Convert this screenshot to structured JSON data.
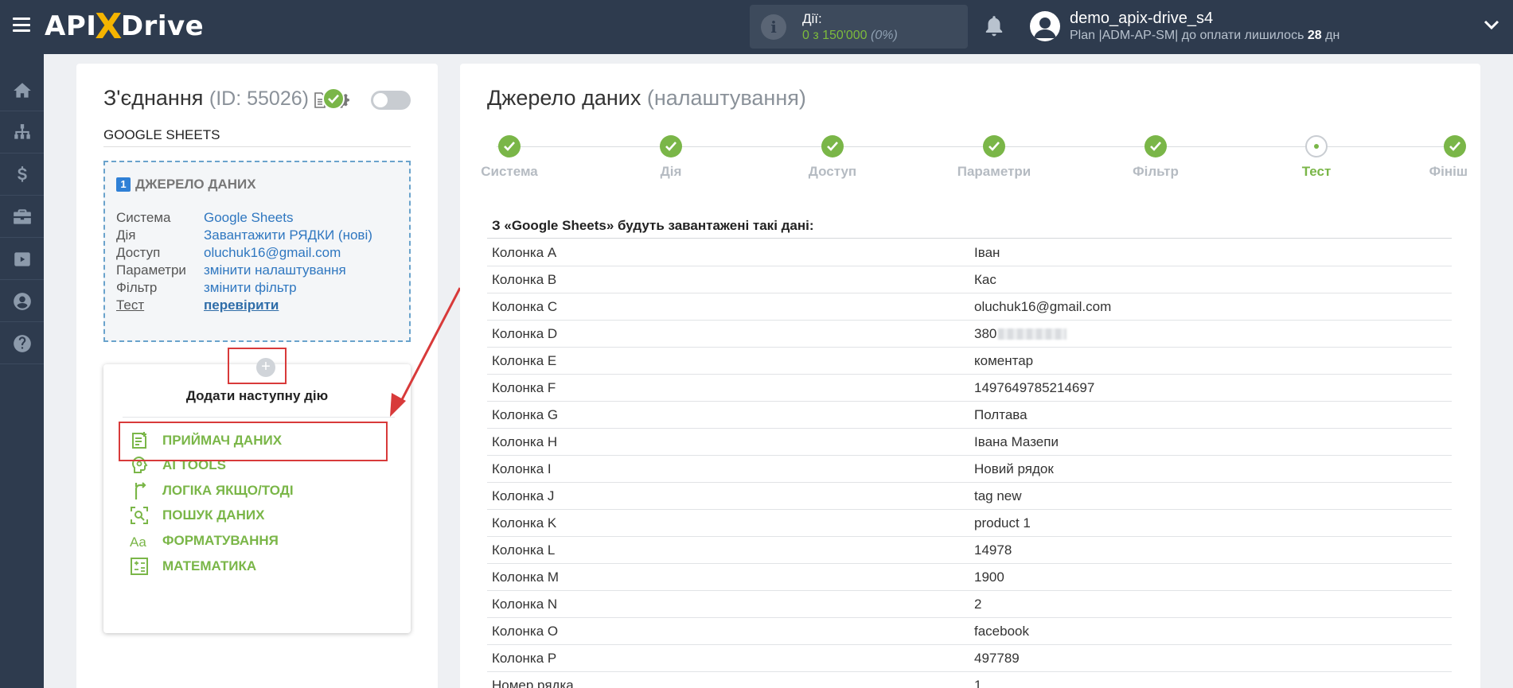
{
  "header": {
    "logo": {
      "part1": "API",
      "x": "X",
      "part2": "Drive"
    },
    "actions_label": "Дії:",
    "actions_value": "0 з 150'000",
    "actions_percent": "(0%)",
    "user_name": "demo_apix-drive_s4",
    "plan_text": "Plan |ADM-AP-SM| до оплати лишилось ",
    "plan_days": "28",
    "plan_days_unit": " дн"
  },
  "nav": {
    "icons": [
      "home-icon",
      "sitemap-icon",
      "dollar-icon",
      "briefcase-icon",
      "youtube-icon",
      "user-icon",
      "help-icon"
    ]
  },
  "connection": {
    "title": "З'єднання",
    "id_text": "(ID: 55026)",
    "service_title": "GOOGLE SHEETS",
    "source": {
      "number": "1",
      "heading": "ДЖЕРЕЛО ДАНИХ",
      "rows": [
        {
          "key": "Система",
          "value": "Google Sheets"
        },
        {
          "key": "Дія",
          "value": "Завантажити РЯДКИ (нові)"
        },
        {
          "key": "Доступ",
          "value": "oluchuk16@gmail.com"
        },
        {
          "key": "Параметри",
          "value": "змінити налаштування"
        },
        {
          "key": "Фільтр",
          "value": "змінити фільтр"
        },
        {
          "key": "Тест",
          "value": "перевірити"
        }
      ]
    },
    "add_next": {
      "title": "Додати наступну дію",
      "items": [
        {
          "label": "ПРИЙМАЧ ДАНИХ",
          "icon": "receiver-icon"
        },
        {
          "label": "AI TOOLS",
          "icon": "ai-head-icon"
        },
        {
          "label": "ЛОГІКА ЯКЩО/ТОДІ",
          "icon": "branch-icon"
        },
        {
          "label": "ПОШУК ДАНИХ",
          "icon": "search-data-icon"
        },
        {
          "label": "ФОРМАТУВАННЯ",
          "icon": "format-icon"
        },
        {
          "label": "МАТЕМАТИКА",
          "icon": "calculator-icon"
        }
      ]
    }
  },
  "source_panel": {
    "title": "Джерело даних",
    "subtitle": "(налаштування)",
    "steps": [
      "Система",
      "Дія",
      "Доступ",
      "Параметри",
      "Фільтр",
      "Тест",
      "Фініш"
    ],
    "current_step": "Тест",
    "table_heading": "З «Google Sheets» будуть завантажені такі дані:",
    "rows": [
      {
        "col": "Колонка A",
        "val": "Іван"
      },
      {
        "col": "Колонка B",
        "val": "Кас"
      },
      {
        "col": "Колонка C",
        "val": "oluchuk16@gmail.com"
      },
      {
        "col": "Колонка D",
        "val": "380"
      },
      {
        "col": "Колонка E",
        "val": "коментар"
      },
      {
        "col": "Колонка F",
        "val": "1497649785214697"
      },
      {
        "col": "Колонка G",
        "val": "Полтава"
      },
      {
        "col": "Колонка H",
        "val": "Івана Мазепи"
      },
      {
        "col": "Колонка I",
        "val": "Новий рядок"
      },
      {
        "col": "Колонка J",
        "val": "tag new"
      },
      {
        "col": "Колонка K",
        "val": "product 1"
      },
      {
        "col": "Колонка L",
        "val": "14978"
      },
      {
        "col": "Колонка M",
        "val": "1900"
      },
      {
        "col": "Колонка N",
        "val": "2"
      },
      {
        "col": "Колонка O",
        "val": "facebook"
      },
      {
        "col": "Колонка P",
        "val": "497789"
      },
      {
        "col": "Номер рядка",
        "val": "1"
      }
    ]
  },
  "colors": {
    "accent_green": "#7ab648",
    "nav_bg": "#2e3b4e",
    "link_blue": "#2f77c0",
    "highlight_red": "#d83a3a"
  }
}
